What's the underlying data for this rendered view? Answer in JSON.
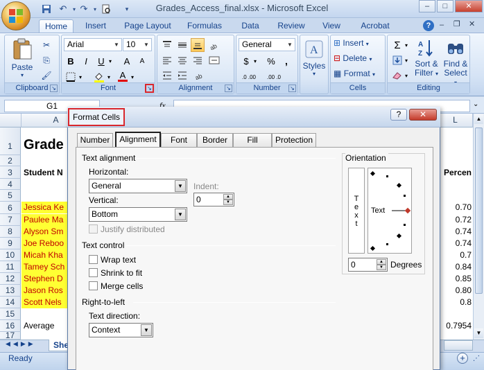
{
  "window": {
    "title": "Grades_Access_final.xlsx - Microsoft Excel",
    "min": "–",
    "max": "□",
    "close": "✕"
  },
  "ribbon": {
    "tabs": [
      "Home",
      "Insert",
      "Page Layout",
      "Formulas",
      "Data",
      "Review",
      "View",
      "Acrobat"
    ],
    "clipboard": {
      "label": "Clipboard",
      "paste": "Paste"
    },
    "font": {
      "label": "Font",
      "name": "Arial",
      "size": "10",
      "bold": "B",
      "italic": "I",
      "underline": "U",
      "grow": "A",
      "shrink": "A",
      "color": "A"
    },
    "alignment": {
      "label": "Alignment"
    },
    "number": {
      "label": "Number",
      "format": "General",
      "currency": "$",
      "percent": "%",
      "comma": ",",
      "inc": ".0 .00",
      "dec": ".00 .0"
    },
    "styles": {
      "label": "Styles"
    },
    "cells": {
      "label": "Cells",
      "insert": "Insert",
      "delete": "Delete",
      "format": "Format"
    },
    "editing": {
      "label": "Editing",
      "sort": "Sort &",
      "filter": "Filter",
      "find": "Find &",
      "select": "Select",
      "sigma": "Σ"
    }
  },
  "formula_bar": {
    "name_box": "G1",
    "fx": "fx"
  },
  "grid": {
    "col_a": "A",
    "col_l": "L",
    "rows": [
      "1",
      "2",
      "3",
      "4",
      "5",
      "6",
      "7",
      "8",
      "9",
      "10",
      "11",
      "12",
      "13",
      "14",
      "15",
      "16",
      "17"
    ],
    "a1": "Grade",
    "a3": "Student N",
    "names": [
      "Jessica Ke",
      "Paulee Ma",
      "Alyson Sm",
      "Joe Reboo",
      "Micah Kha",
      "Tamey Sch",
      "Stephen D",
      "Jason Ros",
      "Scott Nels"
    ],
    "a16": "Average",
    "l3": "Percen",
    "percents": [
      "0.70",
      "0.72",
      "0.74",
      "0.74",
      "0.7",
      "0.84",
      "0.85",
      "0.80",
      "0.8"
    ],
    "l16": "0.7954",
    "sheet_tab": "She"
  },
  "status": {
    "ready": "Ready"
  },
  "dialog": {
    "title": "Format Cells",
    "help": "?",
    "close": "✕",
    "tabs": [
      "Number",
      "Alignment",
      "Font",
      "Border",
      "Fill",
      "Protection"
    ],
    "text_alignment": "Text alignment",
    "horizontal_label": "Horizontal:",
    "horizontal_value": "General",
    "indent_label": "Indent:",
    "indent_value": "0",
    "vertical_label": "Vertical:",
    "vertical_value": "Bottom",
    "justify_distributed": "Justify distributed",
    "text_control": "Text control",
    "wrap_text": "Wrap text",
    "shrink_to_fit": "Shrink to fit",
    "merge_cells": "Merge cells",
    "right_to_left": "Right-to-left",
    "text_direction_label": "Text direction:",
    "text_direction_value": "Context",
    "orientation": "Orientation",
    "vertical_text": [
      "T",
      "e",
      "x",
      "t"
    ],
    "dial_text": "Text",
    "degrees_value": "0",
    "degrees_label": "Degrees"
  }
}
